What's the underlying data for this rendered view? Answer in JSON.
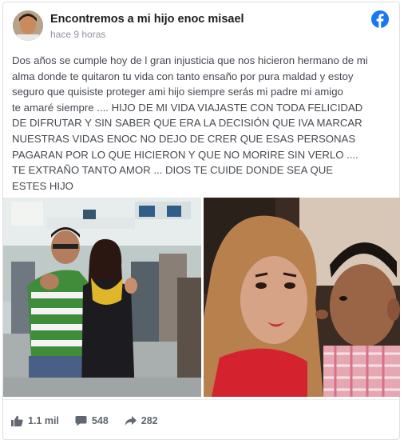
{
  "post": {
    "author": "Encontremos a mi hijo enoc misael",
    "time": "hace 9 horas",
    "text": "Dos años se cumple hoy de l gran injusticia que nos hicieron hermano de mi\nalma donde te quitaron tu vida con tanto ensaño por pura maldad y estoy\nseguro que quisiste proteger ami hijo siempre serás mi padre mi amigo\nte amaré siempre .... HIJO DE MI VIDA VIAJASTE CON TODA FELICIDAD\nDE DIFRUTAR Y SIN SABER QUE ERA LA DECISIÓN QUE IVA MARCAR\nNUESTRAS VIDAS ENOC NO DEJO DE CRER QUE ESAS PERSONAS\nPAGARAN POR LO QUE HICIERON Y QUE NO MORIRE SIN VERLO ....\nTE EXTRAÑO TANTO AMOR ... DIOS TE CUIDE DONDE SEA QUE\nESTES HIJO"
  },
  "stats": {
    "likes": "1.1 mil",
    "comments": "548",
    "shares": "282"
  },
  "colors": {
    "brand": "#1877f2",
    "muted": "#606770"
  },
  "icons": {
    "brand_logo": "facebook-logo-icon",
    "like": "thumbs-up-icon",
    "comment": "comment-bubble-icon",
    "share": "share-arrow-icon"
  }
}
